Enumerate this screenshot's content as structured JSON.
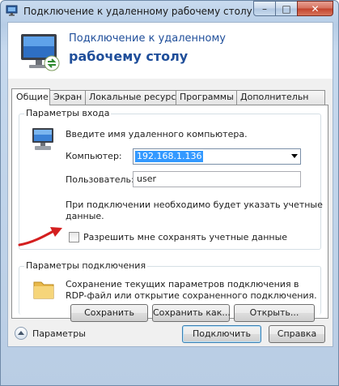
{
  "window": {
    "title": "Подключение к удаленному рабочему столу",
    "controls": {
      "minimize": "–",
      "maximize": "□",
      "close": "✕"
    }
  },
  "banner": {
    "line1": "Подключение к удаленному",
    "line2": "рабочему столу"
  },
  "tabs": [
    {
      "label": "Общие",
      "active": true
    },
    {
      "label": "Экран",
      "active": false
    },
    {
      "label": "Локальные ресурсы",
      "active": false
    },
    {
      "label": "Программы",
      "active": false
    },
    {
      "label": "Дополнительн",
      "active": false
    }
  ],
  "logon": {
    "group_title": "Параметры входа",
    "prompt": "Введите имя удаленного компьютера.",
    "computer_label": "Компьютер:",
    "computer_value": "192.168.1.136",
    "user_label": "Пользователь:",
    "user_value": "user",
    "note_line1": "При подключении необходимо будет указать учетные",
    "note_line2": "данные.",
    "allow_save_label": "Разрешить мне сохранять учетные данные",
    "allow_save_checked": false
  },
  "connection": {
    "group_title": "Параметры подключения",
    "desc_line1": "Сохранение текущих параметров подключения в",
    "desc_line2": "RDP-файл или открытие сохраненного подключения.",
    "save_button": "Сохранить",
    "save_as_button": "Сохранить как...",
    "open_button": "Открыть..."
  },
  "footer": {
    "options_label": "Параметры",
    "connect_button": "Подключить",
    "help_button": "Справка"
  },
  "colors": {
    "banner_text": "#1f4e9a",
    "selection": "#3399ff",
    "annotation_arrow": "#d41f1f"
  }
}
